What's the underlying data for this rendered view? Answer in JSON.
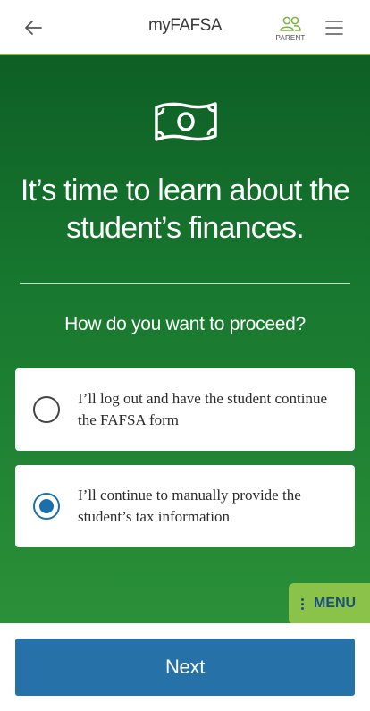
{
  "header": {
    "title": "myFAFSA",
    "role_label": "PARENT",
    "back_icon": "arrow-left-icon",
    "role_icon": "users-icon",
    "menu_icon": "hamburger-icon"
  },
  "hero": {
    "icon": "money-bill-icon",
    "headline": "It’s time to learn about the student’s finances.",
    "question": "How do you want to proceed?"
  },
  "options": [
    {
      "label": "I’ll log out and have the student continue the FAFSA form",
      "selected": false
    },
    {
      "label": "I’ll continue to manually provide the student’s tax information",
      "selected": true
    }
  ],
  "floating_menu": {
    "label": "MENU"
  },
  "footer": {
    "next_label": "Next"
  },
  "colors": {
    "hero_top": "#0e5f25",
    "hero_bottom": "#2b9038",
    "accent_green": "#8bc34a",
    "primary_blue": "#2571a8"
  }
}
